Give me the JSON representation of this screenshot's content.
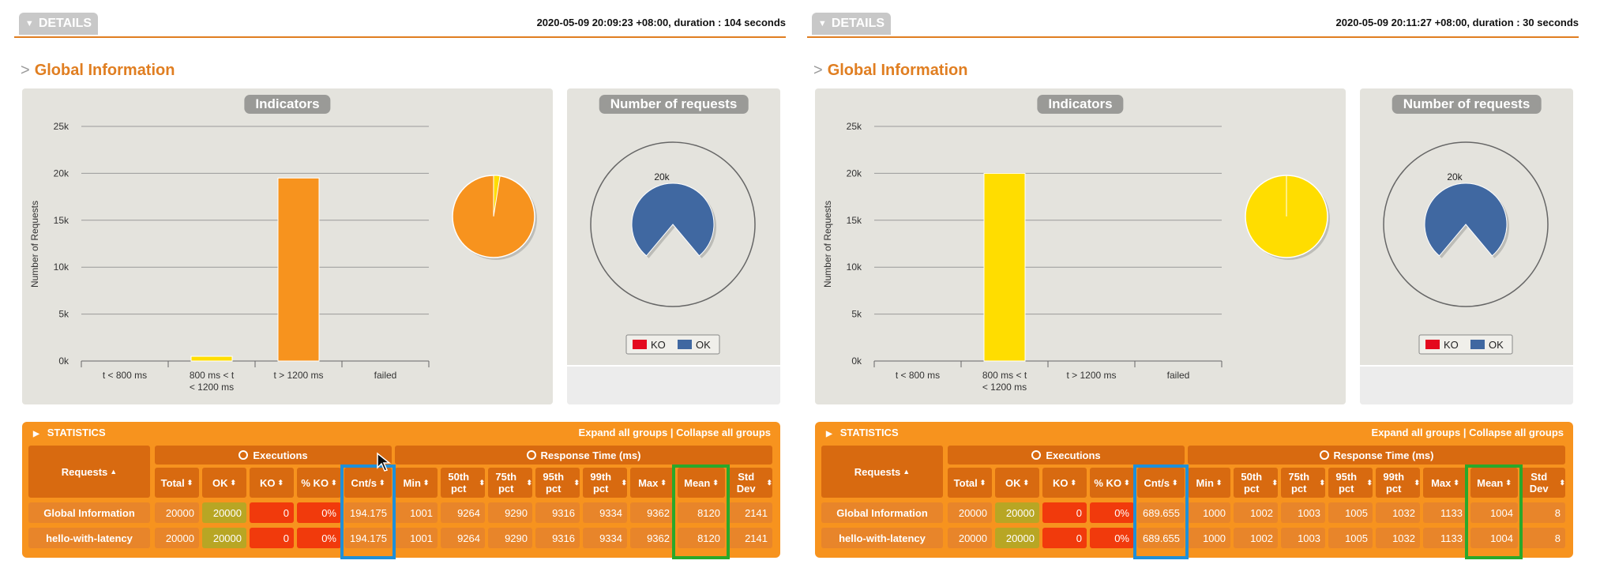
{
  "reports": [
    {
      "details_label": "DETAILS",
      "run_info": "2020-05-09 20:09:23 +08:00, duration : 104 seconds",
      "section_title": "Global Information",
      "indicators_title": "Indicators",
      "requests_title": "Number of requests",
      "legend": {
        "ko": "KO",
        "ok": "OK"
      },
      "donut_label": "20k",
      "statistics_label": "STATISTICS",
      "statistics_links": "Expand all groups | Collapse all groups",
      "rows": [
        {
          "name": "Global Information",
          "total": "20000",
          "ok": "20000",
          "ko": "0",
          "pct_ko": "0%",
          "cnt": "194.175",
          "min": "1001",
          "p50": "9264",
          "p75": "9290",
          "p95": "9316",
          "p99": "9334",
          "max": "9362",
          "mean": "8120",
          "std": "2141"
        },
        {
          "name": "hello-with-latency",
          "total": "20000",
          "ok": "20000",
          "ko": "0",
          "pct_ko": "0%",
          "cnt": "194.175",
          "min": "1001",
          "p50": "9264",
          "p75": "9290",
          "p95": "9316",
          "p99": "9334",
          "max": "9362",
          "mean": "8120",
          "std": "2141"
        }
      ],
      "pie": {
        "ok_share": 0.98,
        "ko_share": 0.02
      }
    },
    {
      "details_label": "DETAILS",
      "run_info": "2020-05-09 20:11:27 +08:00, duration : 30 seconds",
      "section_title": "Global Information",
      "indicators_title": "Indicators",
      "requests_title": "Number of requests",
      "legend": {
        "ko": "KO",
        "ok": "OK"
      },
      "donut_label": "20k",
      "statistics_label": "STATISTICS",
      "statistics_links": "Expand all groups | Collapse all groups",
      "rows": [
        {
          "name": "Global Information",
          "total": "20000",
          "ok": "20000",
          "ko": "0",
          "pct_ko": "0%",
          "cnt": "689.655",
          "min": "1000",
          "p50": "1002",
          "p75": "1003",
          "p95": "1005",
          "p99": "1032",
          "max": "1133",
          "mean": "1004",
          "std": "8"
        },
        {
          "name": "hello-with-latency",
          "total": "20000",
          "ok": "20000",
          "ko": "0",
          "pct_ko": "0%",
          "cnt": "689.655",
          "min": "1000",
          "p50": "1002",
          "p75": "1003",
          "p95": "1005",
          "p99": "1032",
          "max": "1133",
          "mean": "1004",
          "std": "8"
        }
      ],
      "pie": {
        "ok_share": 0.998,
        "ko_share": 0.002
      }
    }
  ],
  "table_headers": {
    "requests": "Requests",
    "executions": "Executions",
    "response_time": "Response Time (ms)",
    "total": "Total",
    "ok": "OK",
    "ko": "KO",
    "pct_ko": "% KO",
    "cnt": "Cnt/s",
    "min": "Min",
    "p50": "50th pct",
    "p75": "75th pct",
    "p95": "95th pct",
    "p99": "99th pct",
    "max": "Max",
    "mean": "Mean",
    "std": "Std Dev"
  },
  "colors": {
    "accent": "#e07e21",
    "bar_orange": "#f7931e",
    "bar_yellow": "#ffdd00",
    "ok_blue": "#4068a1",
    "ko_red": "#e4081d",
    "panel_bg": "#e4e3dd"
  },
  "chart_data": [
    {
      "type": "bar",
      "title": "Indicators",
      "ylabel": "Number of Requests",
      "categories": [
        "t < 800 ms",
        "800 ms < t < 1200 ms",
        "t > 1200 ms",
        "failed"
      ],
      "values": [
        0,
        500,
        19500,
        0
      ],
      "bar_colors": [
        "#4cb049",
        "#ffdd00",
        "#f7931e",
        "#e4081d"
      ],
      "ylim": [
        0,
        25000
      ],
      "yticks": [
        "0k",
        "5k",
        "10k",
        "15k",
        "20k",
        "25k"
      ],
      "grid": true
    },
    {
      "type": "bar",
      "title": "Indicators",
      "ylabel": "Number of Requests",
      "categories": [
        "t < 800 ms",
        "800 ms < t < 1200 ms",
        "t > 1200 ms",
        "failed"
      ],
      "values": [
        0,
        20000,
        0,
        0
      ],
      "bar_colors": [
        "#4cb049",
        "#ffdd00",
        "#f7931e",
        "#e4081d"
      ],
      "ylim": [
        0,
        25000
      ],
      "yticks": [
        "0k",
        "5k",
        "10k",
        "15k",
        "20k",
        "25k"
      ],
      "grid": true
    }
  ]
}
